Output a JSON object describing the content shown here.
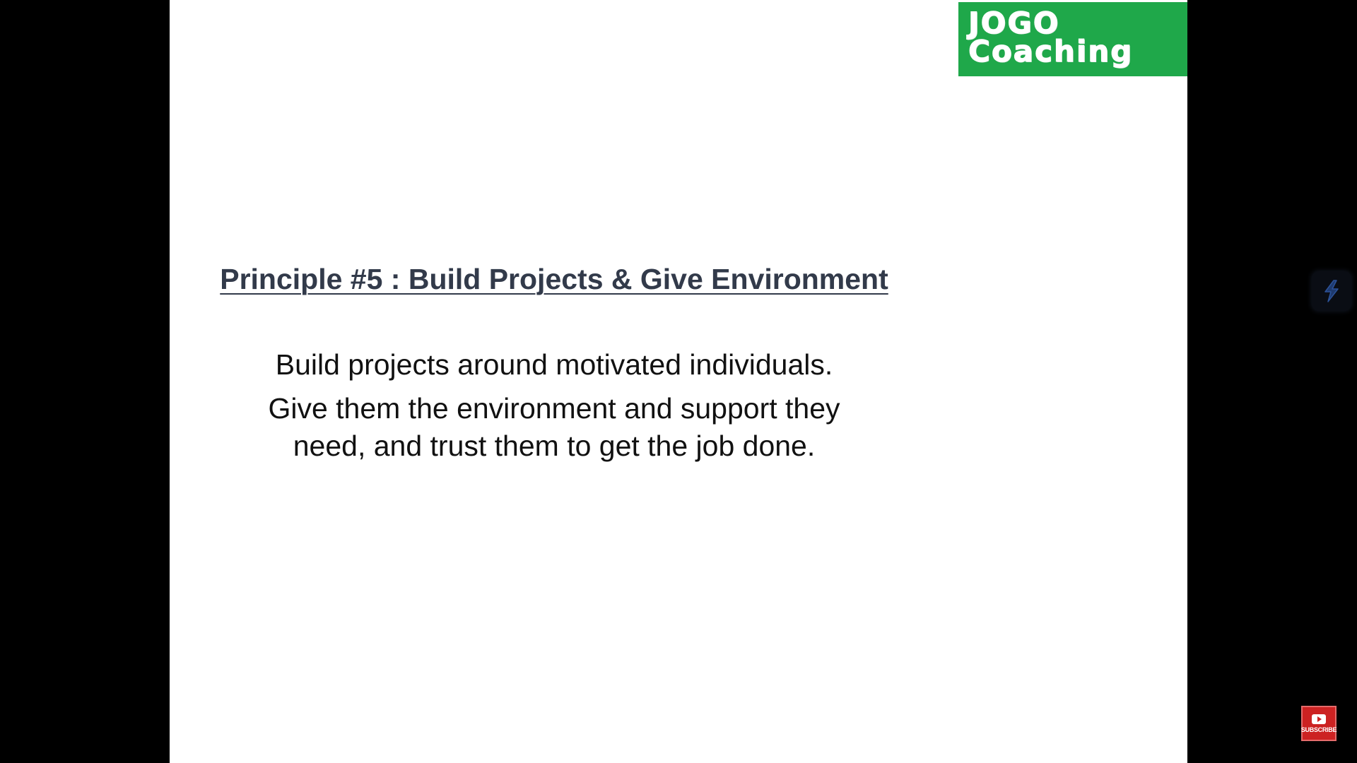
{
  "logo": {
    "line1": "JOGO",
    "line2": "Coaching",
    "color": "#1fa84a"
  },
  "slide": {
    "title": "Principle #5 : Build Projects & Give Environment",
    "lines": [
      "Build projects around motivated individuals.",
      "Give them the environment and support they",
      "need, and trust them to get the job done."
    ]
  },
  "overlay": {
    "side_widget_icon": "lightning-icon",
    "subscribe_label": "SUBSCRIBE",
    "subscribe_icon": "youtube-play-icon",
    "subscribe_color": "#cc2222"
  }
}
